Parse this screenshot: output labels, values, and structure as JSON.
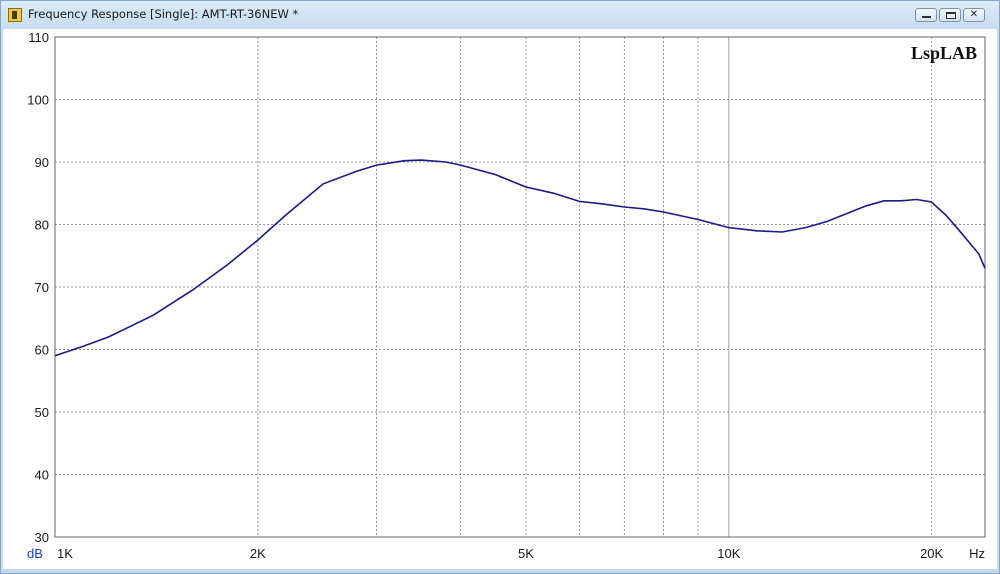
{
  "window": {
    "title": "Frequency Response [Single]: AMT-RT-36NEW *",
    "minimize_icon": "minimize-icon",
    "maximize_icon": "maximize-icon",
    "close_icon": "close-icon",
    "close_glyph": "✕"
  },
  "chart_data": {
    "type": "line",
    "title": "",
    "watermark": "LspLAB",
    "xlabel": "Hz",
    "ylabel": "dB",
    "x_scale": "log",
    "xlim": [
      1000,
      24000
    ],
    "ylim": [
      30,
      110
    ],
    "grid": true,
    "y_ticks": [
      "110",
      "100",
      "90",
      "80",
      "70",
      "60",
      "50",
      "40",
      "30"
    ],
    "x_ticks": [
      {
        "value": 1000,
        "label": "1K"
      },
      {
        "value": 2000,
        "label": "2K"
      },
      {
        "value": 5000,
        "label": "5K"
      },
      {
        "value": 10000,
        "label": "10K"
      },
      {
        "value": 20000,
        "label": "20K"
      }
    ],
    "series": [
      {
        "color": "#1a1a8c",
        "x": [
          1000,
          1100,
          1200,
          1400,
          1600,
          1800,
          2000,
          2200,
          2500,
          2800,
          3000,
          3300,
          3500,
          3800,
          4000,
          4500,
          5000,
          5500,
          6000,
          6500,
          7000,
          7500,
          8000,
          9000,
          10000,
          11000,
          12000,
          13000,
          14000,
          15000,
          16000,
          17000,
          18000,
          19000,
          20000,
          20500,
          21000,
          22000,
          23000,
          23500,
          24000
        ],
        "y": [
          59.0,
          60.5,
          62.0,
          65.5,
          69.5,
          73.5,
          77.5,
          81.5,
          86.5,
          88.5,
          89.5,
          90.2,
          90.3,
          90.0,
          89.5,
          88.0,
          86.0,
          85.0,
          83.7,
          83.3,
          82.8,
          82.5,
          82.0,
          80.8,
          79.5,
          79.0,
          78.8,
          79.5,
          80.5,
          81.8,
          83.0,
          83.8,
          83.8,
          84.0,
          83.6,
          82.5,
          81.5,
          79.0,
          76.5,
          75.3,
          73.0
        ]
      }
    ]
  }
}
